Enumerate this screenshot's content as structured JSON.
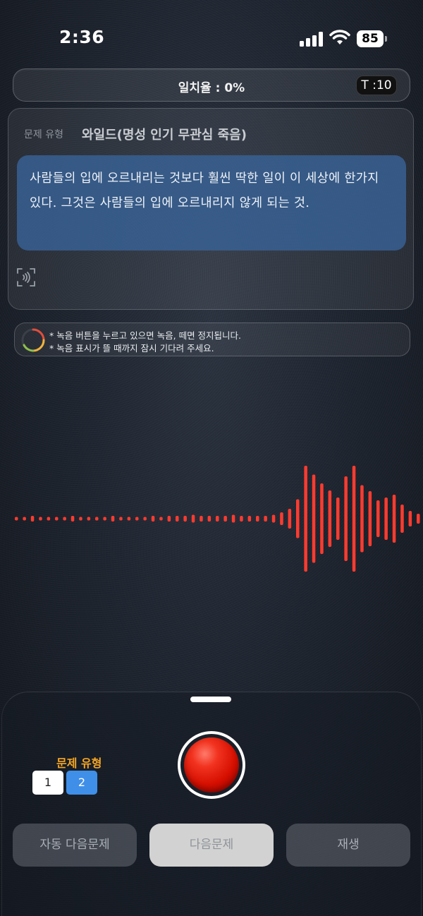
{
  "status_bar": {
    "time": "2:36",
    "battery_level": "85",
    "icons": [
      "signal-icon",
      "wifi-icon",
      "battery-icon"
    ]
  },
  "header": {
    "match_rate": "일치율 : 0%",
    "timer": "T :10"
  },
  "question": {
    "type_label": "문제 유형",
    "type_value": "와일드(명성 인기 무관심 죽음)",
    "quote": "사람들의 입에 오르내리는 것보다 훨씬 딱한 일이 이 세상에 한가지 있다. 그것은 사람들의 입에 오르내리지 않게 되는 것."
  },
  "hint": {
    "line1": "* 녹음 버튼을 누르고 있으면 녹음, 떼면 정지됩니다.",
    "line2": "* 녹음 표시가 뜰 때까지 잠시 기다려 주세요."
  },
  "controls": {
    "type_title": "문제 유형",
    "type_options": [
      "1",
      "2"
    ],
    "selected_type": "2",
    "auto_next_label": "자동 다음문제",
    "next_label": "다음문제",
    "play_label": "재생"
  },
  "colors": {
    "accent_blue": "#3f8fe8",
    "record_red": "#e01a0a",
    "waveform_red": "#ff3b30",
    "type_title_orange": "#f5a623"
  }
}
